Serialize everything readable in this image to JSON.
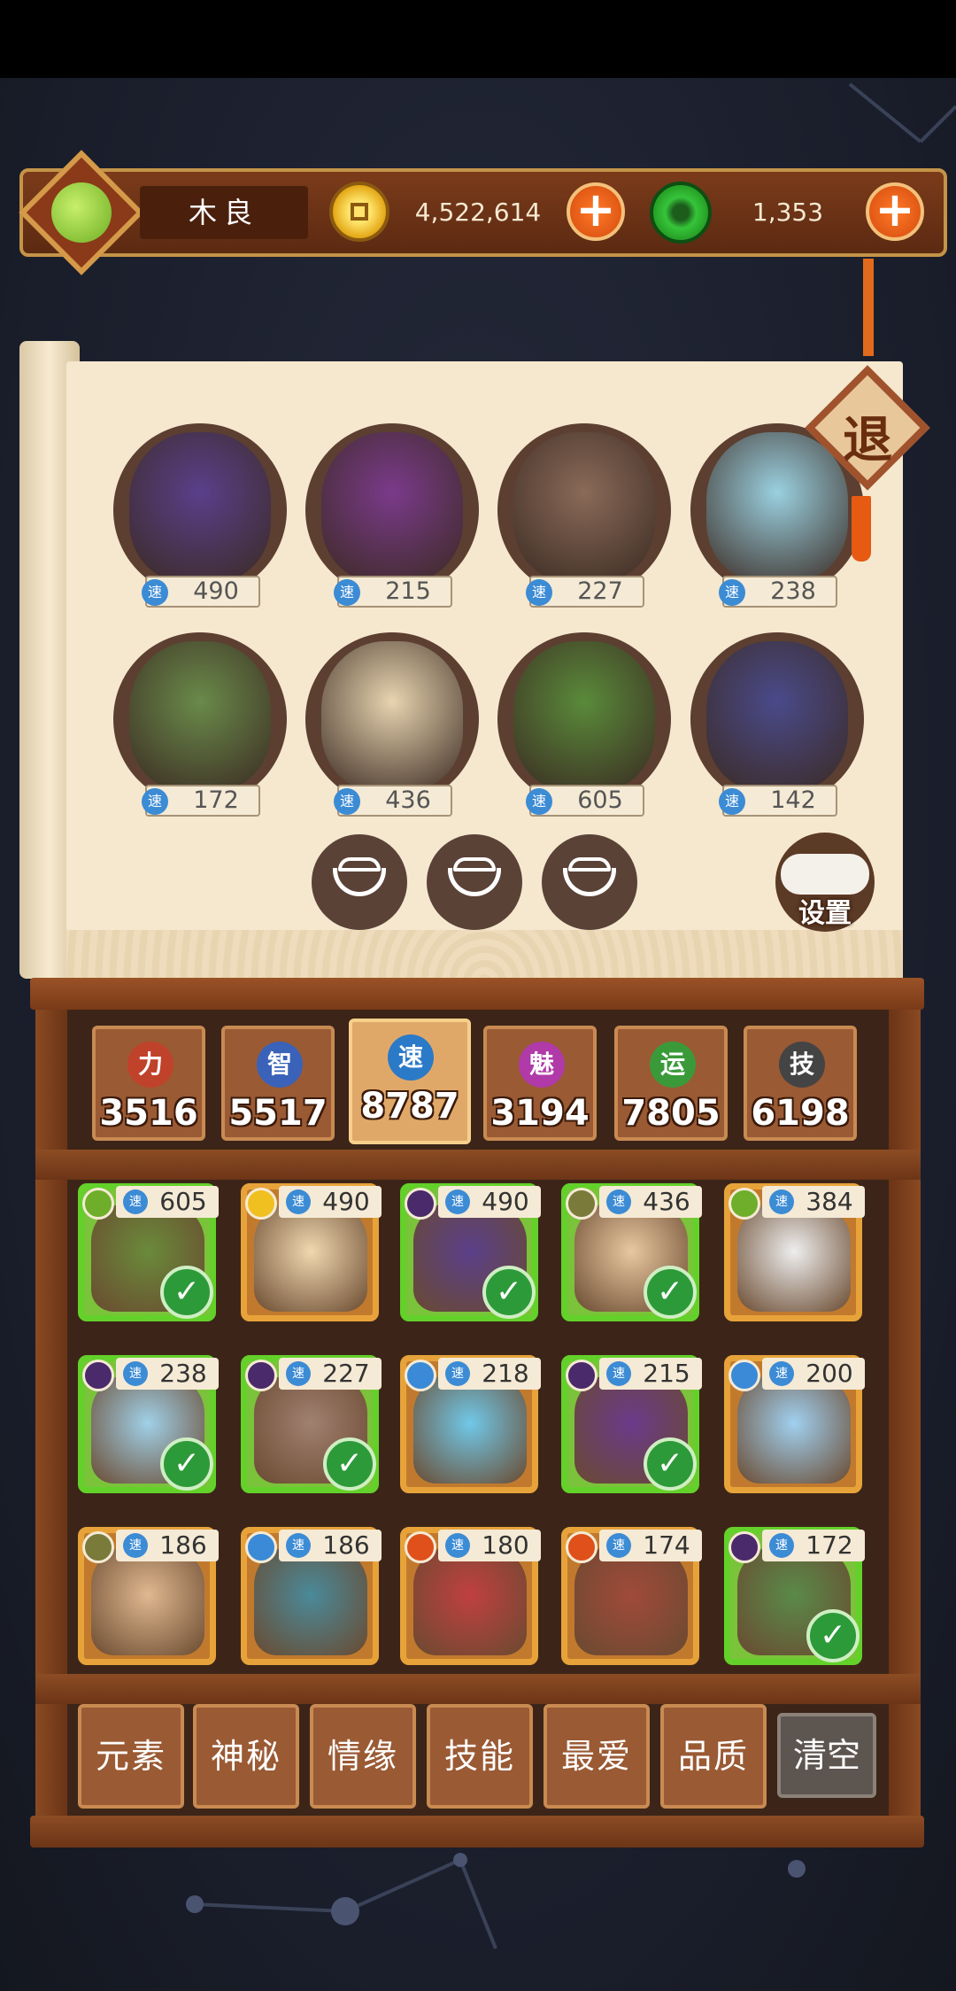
{
  "header": {
    "player_name": "木良",
    "coins": "4,522,614",
    "gems": "1,353",
    "add_label": "+"
  },
  "exit_label": "退",
  "speed_icon_label": "速",
  "team": [
    {
      "name": "dark-wizard",
      "speed": "490",
      "color": "#5a3f8a"
    },
    {
      "name": "purple-empress",
      "speed": "215",
      "color": "#7a3a8a"
    },
    {
      "name": "horned-archer",
      "speed": "227",
      "color": "#8a6a58"
    },
    {
      "name": "white-beast",
      "speed": "238",
      "color": "#9ad0e0"
    },
    {
      "name": "mouse-girl",
      "speed": "172",
      "color": "#6a8a4a"
    },
    {
      "name": "cow-in-box",
      "speed": "436",
      "color": "#e8d4b0"
    },
    {
      "name": "winged-archer",
      "speed": "605",
      "color": "#5a8a3a"
    },
    {
      "name": "silver-knight",
      "speed": "142",
      "color": "#4a4a8a"
    }
  ],
  "settings_label": "设置",
  "stats": [
    {
      "icon": "力",
      "value": "3516",
      "color": "#c0422a"
    },
    {
      "icon": "智",
      "value": "5517",
      "color": "#3a62b8"
    },
    {
      "icon": "速",
      "value": "8787",
      "color": "#2b7ac8"
    },
    {
      "icon": "魅",
      "value": "3194",
      "color": "#b03aa8"
    },
    {
      "icon": "运",
      "value": "7805",
      "color": "#3a9a3a"
    },
    {
      "icon": "技",
      "value": "6198",
      "color": "#444444"
    }
  ],
  "roster": [
    {
      "speed": "605",
      "selected": true,
      "element": "#6fae2a",
      "color": "#6a8a3a"
    },
    {
      "speed": "490",
      "selected": false,
      "element": "#f0c020",
      "color": "#f0d8b0"
    },
    {
      "speed": "490",
      "selected": true,
      "element": "#4a2a6a",
      "color": "#5a3f8a"
    },
    {
      "speed": "436",
      "selected": true,
      "element": "#7a7a3a",
      "color": "#e8c8a0"
    },
    {
      "speed": "384",
      "selected": false,
      "element": "#6fae2a",
      "color": "#eeeeee"
    },
    {
      "speed": "238",
      "selected": true,
      "element": "#4a2a6a",
      "color": "#a0d0e8"
    },
    {
      "speed": "227",
      "selected": true,
      "element": "#4a2a6a",
      "color": "#a08070"
    },
    {
      "speed": "218",
      "selected": false,
      "element": "#3a8ad8",
      "color": "#70c8e8"
    },
    {
      "speed": "215",
      "selected": true,
      "element": "#4a2a6a",
      "color": "#6a3a8a"
    },
    {
      "speed": "200",
      "selected": false,
      "element": "#3a8ad8",
      "color": "#a0d0f0"
    },
    {
      "speed": "186",
      "selected": false,
      "element": "#7a7a3a",
      "color": "#e0b890"
    },
    {
      "speed": "186",
      "selected": false,
      "element": "#3a8ad8",
      "color": "#4a8a9a"
    },
    {
      "speed": "180",
      "selected": false,
      "element": "#e0501a",
      "color": "#c04040"
    },
    {
      "speed": "174",
      "selected": false,
      "element": "#e0501a",
      "color": "#a04a3a"
    },
    {
      "speed": "172",
      "selected": true,
      "element": "#4a2a6a",
      "color": "#5a8a4a"
    }
  ],
  "check_label": "✓",
  "filters": [
    "元素",
    "神秘",
    "情缘",
    "技能",
    "最爱",
    "品质"
  ],
  "clear_label": "清空"
}
